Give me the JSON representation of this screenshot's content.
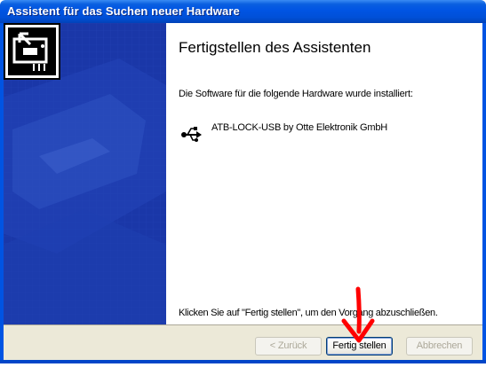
{
  "window": {
    "title": "Assistent für das Suchen neuer Hardware"
  },
  "banner": {
    "icon": "hardware-card-icon",
    "background_color": "#1a37a8"
  },
  "content": {
    "heading": "Fertigstellen des Assistenten",
    "subtext": "Die Software für die folgende Hardware wurde installiert:",
    "device": {
      "icon": "usb-icon",
      "name": "ATB-LOCK-USB by Otte Elektronik GmbH"
    },
    "finish_instruction": "Klicken Sie auf \"Fertig stellen\", um den Vorgang abzuschließen."
  },
  "buttons": {
    "back_label": "< Zurück",
    "finish_label": "Fertig stellen",
    "cancel_label": "Abbrechen"
  },
  "annotation": {
    "type": "red-arrow-pointing-down",
    "color": "#ff0000"
  }
}
